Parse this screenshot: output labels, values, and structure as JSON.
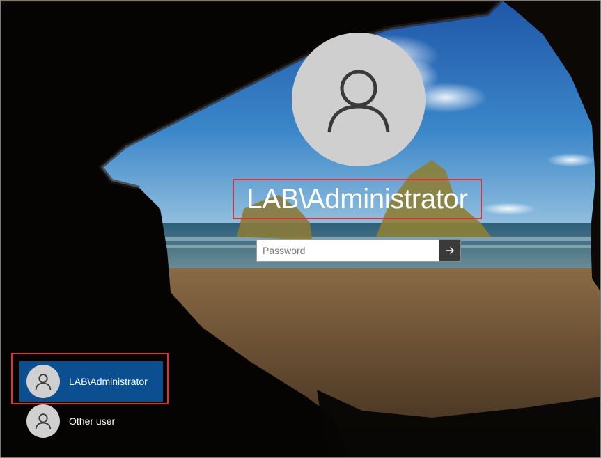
{
  "lockscreen": {
    "username": "LAB\\Administrator",
    "password": {
      "placeholder": "Password",
      "value": ""
    },
    "submit_icon": "arrow-right-icon",
    "avatar_icon": "user-silhouette-icon"
  },
  "user_list": [
    {
      "label": "LAB\\Administrator",
      "selected": true
    },
    {
      "label": "Other user",
      "selected": false
    }
  ],
  "colors": {
    "highlight_border": "#d9343a",
    "selected_user_bg": "#0b4f91",
    "avatar_bg": "#cfcfcf"
  }
}
